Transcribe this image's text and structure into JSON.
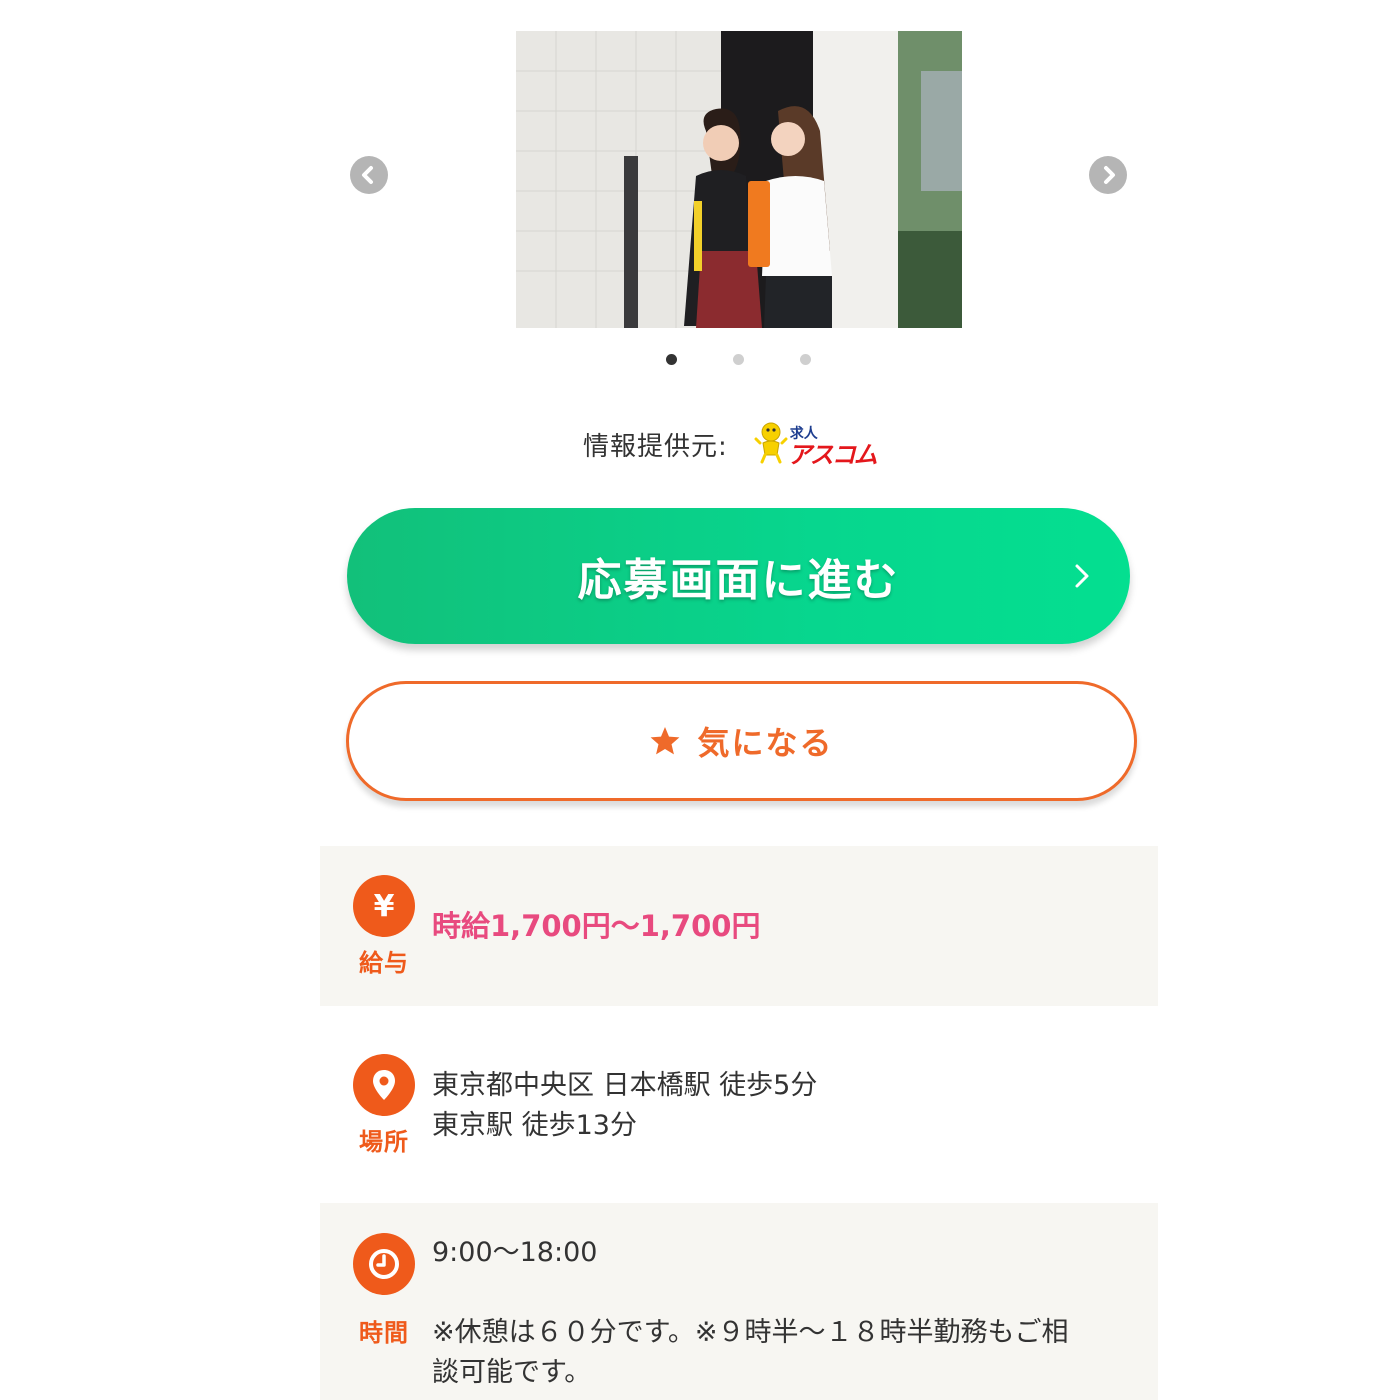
{
  "carousel": {
    "slide_count": 3,
    "active_index": 0,
    "prev_icon": "chevron-left-icon",
    "next_icon": "chevron-right-icon"
  },
  "provider": {
    "label": "情報提供元:",
    "logo_small": "求人",
    "logo_big": "アスコム"
  },
  "apply_button": {
    "label": "応募画面に進む",
    "color": "#07d68e"
  },
  "favorite_button": {
    "label": "気になる",
    "icon": "star-icon",
    "color": "#ef6a2a"
  },
  "details": {
    "salary": {
      "icon": "yen-icon",
      "icon_text": "¥",
      "caption": "給与",
      "value": "時給1,700円〜1,700円"
    },
    "place": {
      "icon": "map-pin-icon",
      "caption": "場所",
      "line1": "東京都中央区 日本橋駅 徒歩5分",
      "line2": "東京駅 徒歩13分"
    },
    "time": {
      "icon": "clock-icon",
      "caption": "時間",
      "hours": "9:00〜18:00",
      "note_line1": "※休憩は６０分です。※９時半〜１８時半勤務もご相",
      "note_line2": "談可能です。"
    }
  },
  "accent_color": "#ef5a1b",
  "salary_color": "#e84a7f"
}
